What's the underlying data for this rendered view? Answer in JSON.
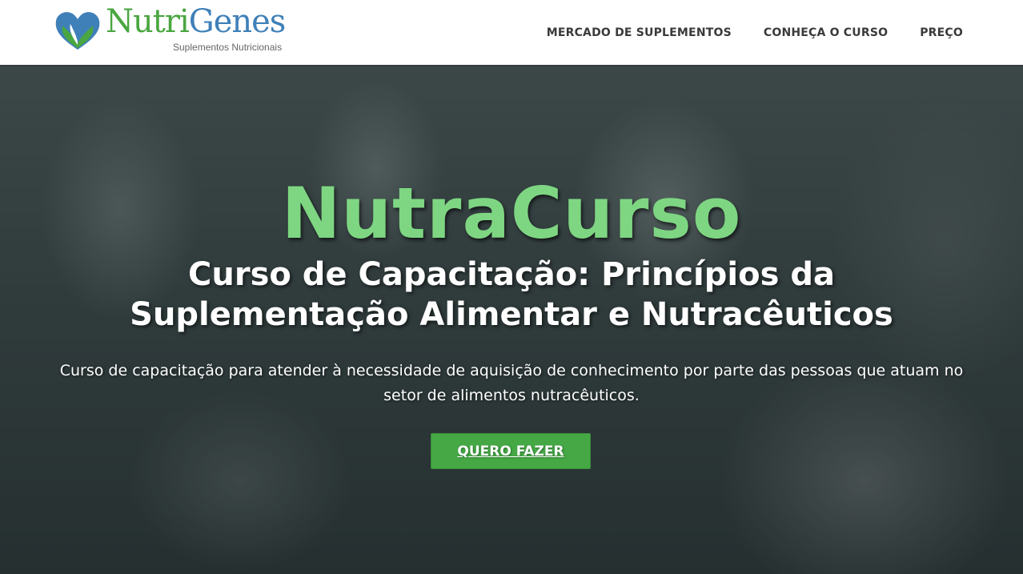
{
  "brand": {
    "name_part1": "Nutri",
    "name_part2": "Genes",
    "tagline": "Suplementos Nutricionais",
    "icon": "heart-leaf-icon",
    "colors": {
      "green": "#4aa640",
      "blue": "#3f80b8"
    }
  },
  "nav": {
    "items": [
      {
        "label": "MERCADO DE SUPLEMENTOS"
      },
      {
        "label": "CONHEÇA O CURSO"
      },
      {
        "label": "PREÇO"
      }
    ]
  },
  "hero": {
    "title": "NutraCurso",
    "subtitle_line1": "Curso de Capacitação: Princípios da",
    "subtitle_line2": "Suplementação Alimentar e Nutracêuticos",
    "description_line1": "Curso de capacitação para atender à necessidade de aquisição de conhecimento por parte das pessoas que atuam no",
    "description_line2": "setor de alimentos nutracêuticos.",
    "cta_label": "QUERO FAZER",
    "colors": {
      "title": "#7ed682",
      "cta": "#45a845"
    }
  }
}
